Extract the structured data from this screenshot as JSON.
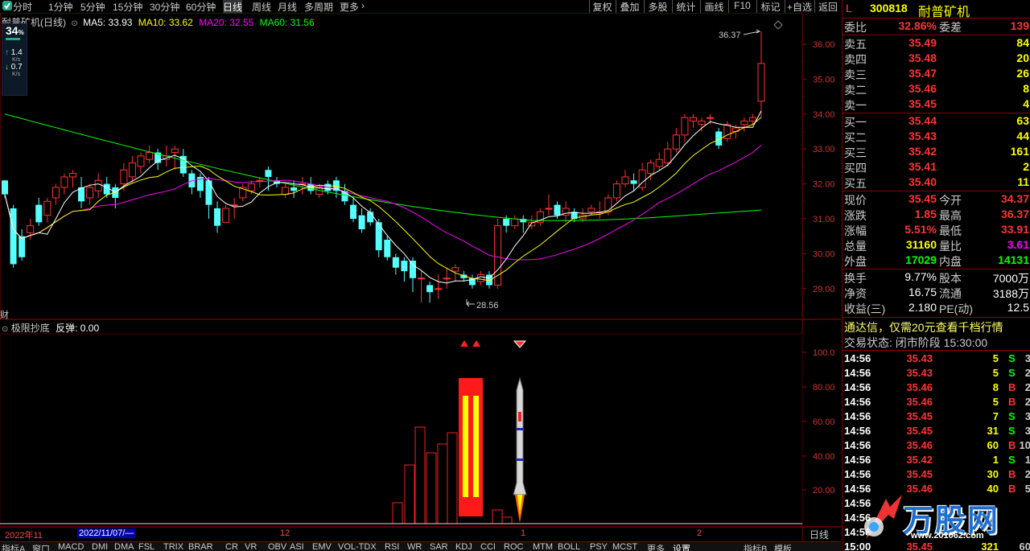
{
  "topbar": {
    "periods": [
      "分时",
      "1分钟",
      "5分钟",
      "15分钟",
      "30分钟",
      "60分钟",
      "日线",
      "周线",
      "月线",
      "多周期",
      "更多"
    ],
    "right_buttons": [
      "复权",
      "叠加",
      "多股",
      "统计",
      "画线",
      "F10",
      "标记",
      "+自选",
      "返回"
    ],
    "active_period": "日线"
  },
  "chart_info": {
    "title": "耐普矿机(日线)",
    "ma5": "MA5: 33.93",
    "ma10": "MA10: 33.62",
    "ma20": "MA20: 32.55",
    "ma60": "MA60: 31.56",
    "colors": {
      "ma5": "#ffffff",
      "ma10": "#ffff00",
      "ma20": "#ff00ff",
      "ma60": "#00ff00"
    }
  },
  "badge": {
    "num": "34",
    "unit": "%",
    "up": "1.4",
    "up_unit": "K/s",
    "down": "0.7",
    "down_unit": "K/s"
  },
  "price_axis": [
    "36.00",
    "35.00",
    "34.00",
    "33.00",
    "32.00",
    "31.00",
    "30.00",
    "29.00"
  ],
  "annotations": {
    "high": "36.37",
    "low": "28.56",
    "finance": "财"
  },
  "indicator": {
    "name": "极限抄底",
    "value_label": "反弹: 0.00"
  },
  "indicator_axis": [
    "100.0",
    "80.00",
    "60.00",
    "40.00",
    "20.00"
  ],
  "date_axis": {
    "d1": "2022年11",
    "d2": "2022/11/07/—",
    "d3": "12",
    "d4": "1",
    "d5": "2",
    "mode": "日线"
  },
  "bottom_tabs": [
    "指标A",
    "窗口",
    "MACD",
    "DMI",
    "DMA",
    "FSL",
    "TRIX",
    "BRAR",
    "CR",
    "VR",
    "OBV",
    "ASI",
    "EMV",
    "VOL-TDX",
    "RSI",
    "WR",
    "SAR",
    "KDJ",
    "CCI",
    "ROC",
    "MTM",
    "BOLL",
    "PSY",
    "MCST",
    "更多",
    "设置",
    "指标B",
    "模板"
  ],
  "stock": {
    "marker": "L",
    "code": "300818",
    "name": "耐普矿机"
  },
  "weibi": {
    "label": "委比",
    "value": "32.86%",
    "diff_label": "委差",
    "diff": "139"
  },
  "sell": [
    {
      "label": "卖五",
      "price": "35.49",
      "vol": "84"
    },
    {
      "label": "卖四",
      "price": "35.48",
      "vol": "20"
    },
    {
      "label": "卖三",
      "price": "35.47",
      "vol": "26"
    },
    {
      "label": "卖二",
      "price": "35.46",
      "vol": "8"
    },
    {
      "label": "卖一",
      "price": "35.45",
      "vol": "4"
    }
  ],
  "buy": [
    {
      "label": "买一",
      "price": "35.44",
      "vol": "63"
    },
    {
      "label": "买二",
      "price": "35.43",
      "vol": "44"
    },
    {
      "label": "买三",
      "price": "35.42",
      "vol": "161"
    },
    {
      "label": "买四",
      "price": "35.41",
      "vol": "2"
    },
    {
      "label": "买五",
      "price": "35.40",
      "vol": "11"
    }
  ],
  "quote": [
    {
      "l1": "现价",
      "v1": "35.45",
      "l2": "今开",
      "v2": "34.37"
    },
    {
      "l1": "涨跌",
      "v1": "1.85",
      "l2": "最高",
      "v2": "36.37"
    },
    {
      "l1": "涨幅",
      "v1": "5.51%",
      "l2": "最低",
      "v2": "33.91"
    },
    {
      "l1": "总量",
      "v1": "31160",
      "l2": "量比",
      "v2": "3.61"
    },
    {
      "l1": "外盘",
      "v1": "17029",
      "l2": "内盘",
      "v2": "14131"
    }
  ],
  "fund": [
    {
      "l1": "换手",
      "v1": "9.77%",
      "l2": "股本",
      "v2": "7000万"
    },
    {
      "l1": "净资",
      "v1": "16.75",
      "l2": "流通",
      "v2": "3188万"
    },
    {
      "l1": "收益(三)",
      "v1": "2.180",
      "l2": "PE(动)",
      "v2": "12.5"
    }
  ],
  "ad": "通达信，仅需20元查看千档行情",
  "trade_status": "交易状态: 闭市阶段 15:30:00",
  "ticks": [
    {
      "time": "14:56",
      "price": "35.43",
      "vol": "5",
      "side": "S",
      "n": "3"
    },
    {
      "time": "14:56",
      "price": "35.43",
      "vol": "5",
      "side": "S",
      "n": "2"
    },
    {
      "time": "14:56",
      "price": "35.46",
      "vol": "8",
      "side": "B",
      "n": "2"
    },
    {
      "time": "14:56",
      "price": "35.46",
      "vol": "5",
      "side": "B",
      "n": "2"
    },
    {
      "time": "14:56",
      "price": "35.45",
      "vol": "7",
      "side": "S",
      "n": "3"
    },
    {
      "time": "14:56",
      "price": "35.45",
      "vol": "31",
      "side": "S",
      "n": "3"
    },
    {
      "time": "14:56",
      "price": "35.46",
      "vol": "60",
      "side": "B",
      "n": "10"
    },
    {
      "time": "14:56",
      "price": "35.42",
      "vol": "1",
      "side": "S",
      "n": "1"
    },
    {
      "time": "14:56",
      "price": "35.45",
      "vol": "30",
      "side": "B",
      "n": "2"
    },
    {
      "time": "14:56",
      "price": "35.46",
      "vol": "40",
      "side": "B",
      "n": "5"
    },
    {
      "time": "14:56",
      "price": "",
      "vol": "",
      "side": "",
      "n": ""
    },
    {
      "time": "14:56",
      "price": "",
      "vol": "",
      "side": "",
      "n": ""
    },
    {
      "time": "14:56",
      "price": "",
      "vol": "",
      "side": "",
      "n": ""
    },
    {
      "time": "15:00",
      "price": "35.45",
      "vol": "321",
      "side": "",
      "n": "60"
    }
  ],
  "watermark": {
    "text": "万股网",
    "url": "www.201062.com"
  },
  "chart_data": {
    "type": "candlestick",
    "price_range": [
      28.2,
      36.9
    ],
    "candles": [
      [
        32.1,
        31.7,
        32.1,
        31.6
      ],
      [
        31.3,
        29.7,
        31.4,
        29.6
      ],
      [
        30.5,
        29.9,
        30.7,
        29.8
      ],
      [
        30.6,
        30.8,
        31.0,
        30.4
      ],
      [
        31.4,
        30.9,
        31.6,
        30.8
      ],
      [
        31.1,
        31.5,
        31.6,
        30.9
      ],
      [
        31.6,
        31.9,
        32.0,
        31.4
      ],
      [
        31.9,
        32.2,
        32.3,
        31.7
      ],
      [
        32.2,
        32.3,
        32.4,
        31.9
      ],
      [
        31.9,
        31.5,
        32.2,
        31.3
      ],
      [
        31.6,
        31.9,
        32.0,
        31.4
      ],
      [
        31.8,
        32.1,
        32.3,
        31.6
      ],
      [
        32.0,
        31.7,
        32.2,
        31.6
      ],
      [
        31.9,
        31.6,
        32.0,
        31.3
      ],
      [
        32.0,
        32.4,
        32.6,
        31.8
      ],
      [
        32.2,
        32.6,
        32.8,
        32.0
      ],
      [
        32.5,
        32.8,
        32.9,
        32.3
      ],
      [
        32.7,
        32.9,
        33.1,
        32.6
      ],
      [
        32.9,
        32.6,
        33.0,
        32.4
      ],
      [
        32.7,
        32.8,
        33.1,
        32.5
      ],
      [
        32.9,
        33.0,
        33.1,
        32.4
      ],
      [
        32.8,
        32.3,
        33.0,
        32.2
      ],
      [
        32.3,
        31.9,
        32.4,
        31.7
      ],
      [
        32.2,
        31.8,
        32.3,
        31.6
      ],
      [
        32.1,
        31.4,
        32.2,
        31.0
      ],
      [
        31.3,
        30.8,
        31.5,
        30.6
      ],
      [
        30.9,
        31.3,
        31.4,
        30.9
      ],
      [
        31.4,
        31.4,
        31.6,
        31.0
      ],
      [
        31.6,
        31.9,
        32.0,
        31.5
      ],
      [
        31.8,
        32.0,
        32.1,
        31.7
      ],
      [
        32.1,
        32.1,
        32.2,
        31.9
      ],
      [
        32.4,
        32.2,
        32.5,
        31.8
      ],
      [
        32.1,
        32.0,
        32.2,
        31.9
      ],
      [
        31.7,
        31.9,
        32.0,
        31.6
      ],
      [
        31.9,
        31.8,
        32.1,
        31.6
      ],
      [
        32.0,
        32.0,
        32.2,
        31.7
      ],
      [
        32.0,
        31.8,
        32.2,
        31.7
      ],
      [
        31.7,
        31.9,
        32.0,
        31.6
      ],
      [
        32.0,
        31.8,
        32.1,
        31.7
      ],
      [
        32.1,
        31.8,
        32.2,
        31.6
      ],
      [
        31.8,
        31.5,
        32.0,
        31.4
      ],
      [
        31.4,
        31.0,
        31.6,
        30.9
      ],
      [
        31.1,
        30.7,
        31.3,
        30.6
      ],
      [
        31.2,
        30.9,
        31.3,
        30.8
      ],
      [
        30.9,
        30.1,
        31.0,
        29.9
      ],
      [
        30.4,
        29.9,
        30.5,
        29.8
      ],
      [
        29.9,
        29.6,
        30.0,
        29.4
      ],
      [
        29.8,
        29.5,
        29.9,
        29.2
      ],
      [
        29.8,
        29.3,
        29.9,
        28.9
      ],
      [
        29.3,
        29.3,
        29.5,
        28.6
      ],
      [
        29.1,
        28.9,
        29.2,
        28.6
      ],
      [
        29.0,
        29.0,
        29.4,
        28.7
      ],
      [
        29.3,
        29.3,
        29.6,
        29.0
      ],
      [
        29.5,
        29.6,
        29.7,
        29.2
      ],
      [
        29.4,
        29.3,
        29.5,
        29.2
      ],
      [
        29.3,
        29.1,
        29.4,
        29.0
      ],
      [
        29.2,
        29.4,
        29.5,
        29.1
      ],
      [
        29.4,
        29.1,
        29.5,
        29.0
      ],
      [
        29.1,
        30.8,
        31.0,
        29.0
      ],
      [
        31.0,
        30.8,
        31.1,
        30.6
      ],
      [
        30.8,
        31.0,
        31.1,
        30.7
      ],
      [
        31.0,
        30.9,
        31.1,
        30.6
      ],
      [
        30.8,
        30.9,
        31.1,
        30.7
      ],
      [
        30.9,
        31.2,
        31.3,
        30.8
      ],
      [
        31.3,
        31.3,
        31.7,
        31.1
      ],
      [
        31.4,
        31.1,
        31.5,
        31.0
      ],
      [
        31.1,
        31.3,
        31.5,
        30.9
      ],
      [
        31.2,
        31.0,
        31.3,
        30.9
      ],
      [
        31.0,
        31.1,
        31.3,
        30.9
      ],
      [
        31.2,
        31.3,
        31.4,
        31.1
      ],
      [
        31.2,
        31.2,
        31.5,
        31.0
      ],
      [
        31.2,
        31.6,
        31.7,
        31.1
      ],
      [
        31.6,
        32.0,
        32.1,
        31.5
      ],
      [
        32.0,
        32.2,
        32.4,
        31.9
      ],
      [
        32.1,
        32.0,
        32.3,
        31.8
      ],
      [
        31.9,
        32.4,
        32.6,
        31.8
      ],
      [
        32.3,
        32.6,
        32.7,
        32.1
      ],
      [
        32.5,
        32.7,
        32.9,
        32.4
      ],
      [
        32.6,
        33.0,
        33.2,
        32.5
      ],
      [
        33.0,
        33.4,
        33.6,
        32.9
      ],
      [
        33.4,
        33.9,
        34.0,
        33.2
      ],
      [
        33.8,
        33.9,
        34.0,
        33.6
      ],
      [
        33.7,
        33.8,
        33.9,
        33.5
      ],
      [
        33.9,
        33.9,
        34.0,
        33.7
      ],
      [
        33.5,
        33.1,
        33.6,
        33.0
      ],
      [
        33.3,
        33.7,
        33.8,
        33.2
      ],
      [
        33.5,
        33.6,
        33.7,
        33.3
      ],
      [
        33.7,
        33.8,
        33.9,
        33.5
      ],
      [
        33.8,
        33.9,
        34.0,
        33.7
      ],
      [
        34.37,
        35.45,
        36.37,
        33.91
      ]
    ]
  }
}
